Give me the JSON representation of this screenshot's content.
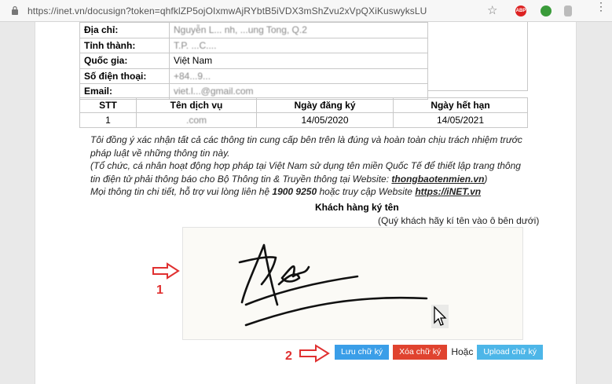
{
  "browser": {
    "url": "https://inet.vn/docusign?token=qhfklZP5ojOIxmwAjRYbtB5iVDX3mShZvu2xVpQXiKuswyksLU"
  },
  "info_rows": [
    {
      "label": "Địa chỉ:",
      "value": "Nguyễn L... nh, ...ung Tong, Q.2"
    },
    {
      "label": "Tỉnh thành:",
      "value": "T.P. ...C...."
    },
    {
      "label": "Quốc gia:",
      "value": "Việt Nam"
    },
    {
      "label": "Số điện thoại:",
      "value": "+84...9..."
    },
    {
      "label": "Email:",
      "value": "viet.l...@gmail.com"
    }
  ],
  "service_table": {
    "headers": [
      "STT",
      "Tên dịch vụ",
      "Ngày đăng ký",
      "Ngày hết hạn"
    ],
    "row": [
      "1",
      ".com",
      "14/05/2020",
      "14/05/2021"
    ]
  },
  "terms": {
    "line1": "Tôi đồng ý xác nhận tất cả các thông tin cung cấp bên trên là đúng và hoàn toàn chịu trách nhiệm trước pháp luật về những thông tin này.",
    "line2_pre": "(Tổ chức, cá nhân hoạt động hợp pháp tại Việt Nam sử dụng tên miền Quốc Tế để thiết lập trang thông tin điện tử phải thông báo cho Bộ Thông tin & Truyền thông tại Website: ",
    "line2_link": "thongbaotenmien.vn",
    "line2_post": ")",
    "line3_pre": "Mọi thông tin chi tiết, hỗ trợ vui lòng liên hệ ",
    "phone": "1900 9250",
    "line3_mid": " hoặc truy cập Website ",
    "line3_link": "https://iNET.vn"
  },
  "signature": {
    "title": "Khách hàng ký tên",
    "hint": "(Quý khách hãy kí tên vào ô bên dưới)"
  },
  "buttons": {
    "save": "Lưu chữ ký",
    "clear": "Xóa chữ ký",
    "or": "Hoặc",
    "upload": "Upload chữ ký"
  },
  "annotations": {
    "one": "1",
    "two": "2"
  },
  "colors": {
    "annotation": "#e03030",
    "save": "#3a9ee8",
    "clear": "#e0432f",
    "upload": "#4db6e8"
  }
}
